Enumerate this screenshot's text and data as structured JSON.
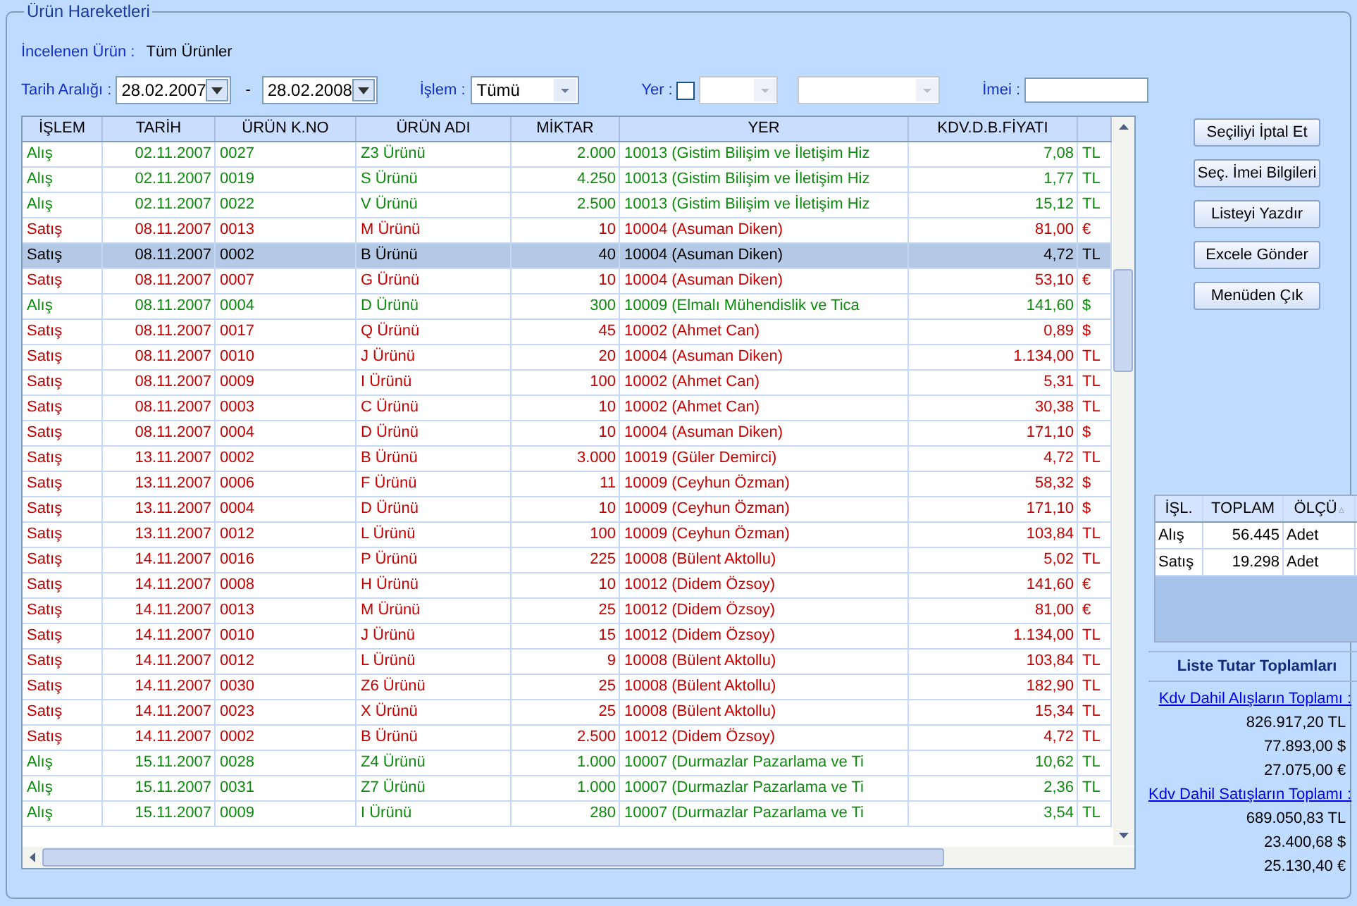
{
  "panel": {
    "title": "Ürün Hareketleri"
  },
  "product": {
    "label": "İncelenen Ürün :",
    "value": "Tüm Ürünler"
  },
  "filters": {
    "date_label": "Tarih Aralığı :",
    "date_from": "28.02.2007",
    "separator": "-",
    "date_to": "28.02.2008",
    "islem_label": "İşlem :",
    "islem_value": "Tümü",
    "yer_label": "Yer :",
    "yer_checked": false,
    "imei_label": "İmei :"
  },
  "table": {
    "columns": [
      "İŞLEM",
      "TARİH",
      "ÜRÜN K.NO",
      "ÜRÜN ADI",
      "MİKTAR",
      "YER",
      "KDV.D.B.FİYATI"
    ],
    "rows": [
      {
        "kind": "alis",
        "selected": false,
        "cells": [
          "Alış",
          "02.11.2007",
          "0027",
          "Z3 Ürünü",
          "2.000",
          "10013 (Gistim Bilişim ve İletişim Hiz",
          "7,08",
          "TL"
        ]
      },
      {
        "kind": "alis",
        "selected": false,
        "cells": [
          "Alış",
          "02.11.2007",
          "0019",
          "S Ürünü",
          "4.250",
          "10013 (Gistim Bilişim ve İletişim Hiz",
          "1,77",
          "TL"
        ]
      },
      {
        "kind": "alis",
        "selected": false,
        "cells": [
          "Alış",
          "02.11.2007",
          "0022",
          "V Ürünü",
          "2.500",
          "10013 (Gistim Bilişim ve İletişim Hiz",
          "15,12",
          "TL"
        ]
      },
      {
        "kind": "satis",
        "selected": false,
        "cells": [
          "Satış",
          "08.11.2007",
          "0013",
          "M Ürünü",
          "10",
          "10004 (Asuman Diken)",
          "81,00",
          "€"
        ]
      },
      {
        "kind": "satis",
        "selected": true,
        "cells": [
          "Satış",
          "08.11.2007",
          "0002",
          "B Ürünü",
          "40",
          "10004 (Asuman Diken)",
          "4,72",
          "TL"
        ]
      },
      {
        "kind": "satis",
        "selected": false,
        "cells": [
          "Satış",
          "08.11.2007",
          "0007",
          "G Ürünü",
          "10",
          "10004 (Asuman Diken)",
          "53,10",
          "€"
        ]
      },
      {
        "kind": "alis",
        "selected": false,
        "cells": [
          "Alış",
          "08.11.2007",
          "0004",
          "D Ürünü",
          "300",
          "10009 (Elmalı Mühendislik ve Tica",
          "141,60",
          "$"
        ]
      },
      {
        "kind": "satis",
        "selected": false,
        "cells": [
          "Satış",
          "08.11.2007",
          "0017",
          "Q Ürünü",
          "45",
          "10002 (Ahmet Can)",
          "0,89",
          "$"
        ]
      },
      {
        "kind": "satis",
        "selected": false,
        "cells": [
          "Satış",
          "08.11.2007",
          "0010",
          "J Ürünü",
          "20",
          "10004 (Asuman Diken)",
          "1.134,00",
          "TL"
        ]
      },
      {
        "kind": "satis",
        "selected": false,
        "cells": [
          "Satış",
          "08.11.2007",
          "0009",
          "I Ürünü",
          "100",
          "10002 (Ahmet Can)",
          "5,31",
          "TL"
        ]
      },
      {
        "kind": "satis",
        "selected": false,
        "cells": [
          "Satış",
          "08.11.2007",
          "0003",
          "C Ürünü",
          "10",
          "10002 (Ahmet Can)",
          "30,38",
          "TL"
        ]
      },
      {
        "kind": "satis",
        "selected": false,
        "cells": [
          "Satış",
          "08.11.2007",
          "0004",
          "D Ürünü",
          "10",
          "10004 (Asuman Diken)",
          "171,10",
          "$"
        ]
      },
      {
        "kind": "satis",
        "selected": false,
        "cells": [
          "Satış",
          "13.11.2007",
          "0002",
          "B Ürünü",
          "3.000",
          "10019 (Güler Demirci)",
          "4,72",
          "TL"
        ]
      },
      {
        "kind": "satis",
        "selected": false,
        "cells": [
          "Satış",
          "13.11.2007",
          "0006",
          "F Ürünü",
          "11",
          "10009 (Ceyhun Özman)",
          "58,32",
          "$"
        ]
      },
      {
        "kind": "satis",
        "selected": false,
        "cells": [
          "Satış",
          "13.11.2007",
          "0004",
          "D Ürünü",
          "10",
          "10009 (Ceyhun Özman)",
          "171,10",
          "$"
        ]
      },
      {
        "kind": "satis",
        "selected": false,
        "cells": [
          "Satış",
          "13.11.2007",
          "0012",
          "L Ürünü",
          "100",
          "10009 (Ceyhun Özman)",
          "103,84",
          "TL"
        ]
      },
      {
        "kind": "satis",
        "selected": false,
        "cells": [
          "Satış",
          "14.11.2007",
          "0016",
          "P Ürünü",
          "225",
          "10008 (Bülent Aktollu)",
          "5,02",
          "TL"
        ]
      },
      {
        "kind": "satis",
        "selected": false,
        "cells": [
          "Satış",
          "14.11.2007",
          "0008",
          "H Ürünü",
          "10",
          "10012 (Didem Özsoy)",
          "141,60",
          "€"
        ]
      },
      {
        "kind": "satis",
        "selected": false,
        "cells": [
          "Satış",
          "14.11.2007",
          "0013",
          "M Ürünü",
          "25",
          "10012 (Didem Özsoy)",
          "81,00",
          "€"
        ]
      },
      {
        "kind": "satis",
        "selected": false,
        "cells": [
          "Satış",
          "14.11.2007",
          "0010",
          "J Ürünü",
          "15",
          "10012 (Didem Özsoy)",
          "1.134,00",
          "TL"
        ]
      },
      {
        "kind": "satis",
        "selected": false,
        "cells": [
          "Satış",
          "14.11.2007",
          "0012",
          "L Ürünü",
          "9",
          "10008 (Bülent Aktollu)",
          "103,84",
          "TL"
        ]
      },
      {
        "kind": "satis",
        "selected": false,
        "cells": [
          "Satış",
          "14.11.2007",
          "0030",
          "Z6 Ürünü",
          "25",
          "10008 (Bülent Aktollu)",
          "182,90",
          "TL"
        ]
      },
      {
        "kind": "satis",
        "selected": false,
        "cells": [
          "Satış",
          "14.11.2007",
          "0023",
          "X Ürünü",
          "25",
          "10008 (Bülent Aktollu)",
          "15,34",
          "TL"
        ]
      },
      {
        "kind": "satis",
        "selected": false,
        "cells": [
          "Satış",
          "14.11.2007",
          "0002",
          "B Ürünü",
          "2.500",
          "10012 (Didem Özsoy)",
          "4,72",
          "TL"
        ]
      },
      {
        "kind": "alis",
        "selected": false,
        "cells": [
          "Alış",
          "15.11.2007",
          "0028",
          "Z4 Ürünü",
          "1.000",
          "10007 (Durmazlar Pazarlama ve Ti",
          "10,62",
          "TL"
        ]
      },
      {
        "kind": "alis",
        "selected": false,
        "cells": [
          "Alış",
          "15.11.2007",
          "0031",
          "Z7 Ürünü",
          "1.000",
          "10007 (Durmazlar Pazarlama ve Ti",
          "2,36",
          "TL"
        ]
      },
      {
        "kind": "alis",
        "selected": false,
        "cells": [
          "Alış",
          "15.11.2007",
          "0009",
          "I Ürünü",
          "280",
          "10007 (Durmazlar Pazarlama ve Ti",
          "3,54",
          "TL"
        ]
      }
    ]
  },
  "buttons": [
    "Seçiliyi İptal Et",
    "Seç. İmei Bilgileri",
    "Listeyi Yazdır",
    "Excele Gönder",
    "Menüden Çık"
  ],
  "summary": {
    "columns": [
      "İŞL.",
      "TOPLAM",
      "ÖLÇÜ"
    ],
    "sort_glyph": "▵",
    "rows": [
      [
        "Alış",
        "56.445",
        "Adet"
      ],
      [
        "Satış",
        "19.298",
        "Adet"
      ]
    ]
  },
  "totals": {
    "title": "Liste Tutar Toplamları",
    "groups": [
      {
        "link": "Kdv Dahil Alışların Toplamı :",
        "values": [
          "826.917,20 TL",
          "77.893,00 $",
          "27.075,00 €"
        ]
      },
      {
        "link": "Kdv Dahil Satışların Toplamı :",
        "values": [
          "689.050,83 TL",
          "23.400,68 $",
          "25.130,40 €"
        ]
      }
    ]
  }
}
